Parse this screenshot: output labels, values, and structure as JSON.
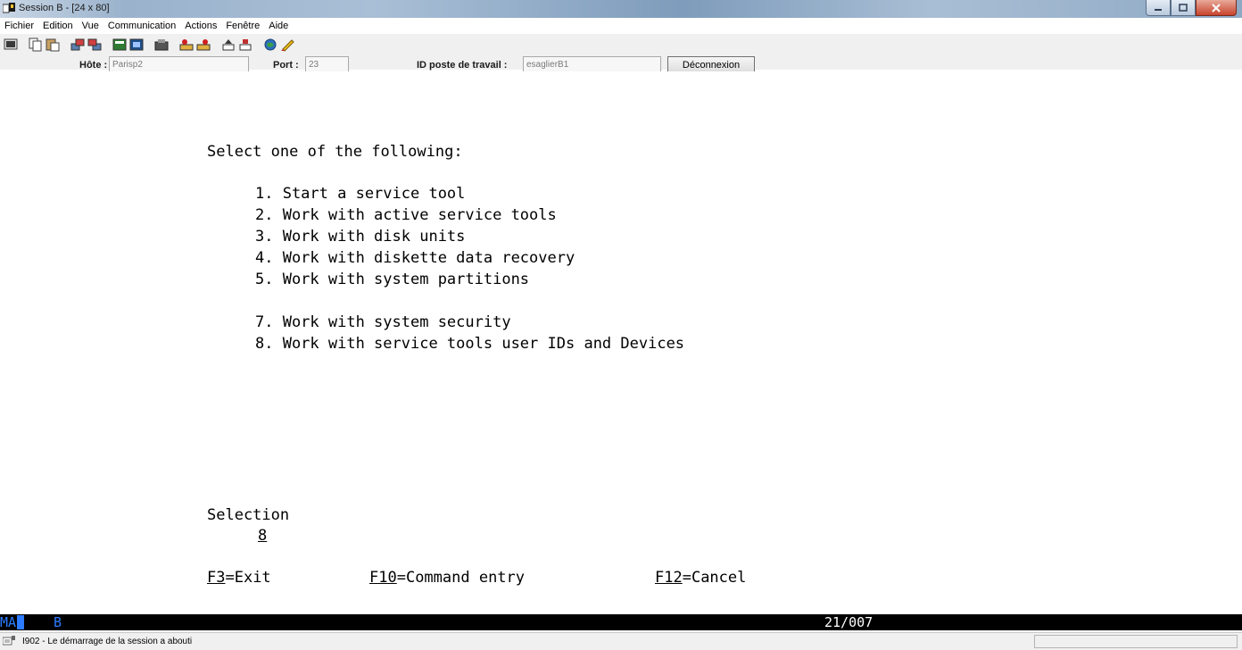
{
  "window": {
    "title": "Session B - [24 x 80]",
    "app_icon": "terminal-session-icon"
  },
  "menu": [
    "Fichier",
    "Edition",
    "Vue",
    "Communication",
    "Actions",
    "Fenêtre",
    "Aide"
  ],
  "toolbar": {
    "icons": [
      "print-screen-icon",
      "copy-icon",
      "paste-icon",
      "send-icon",
      "receive-icon",
      "display-icon",
      "keyboard-icon",
      "macro-icon",
      "record-macro-icon",
      "play-macro-icon",
      "start-icon",
      "stop-icon",
      "globe-icon",
      "help-icon"
    ]
  },
  "connection": {
    "host_label": "Hôte :",
    "host_value": "Parisp2",
    "port_label": "Port :",
    "port_value": "23",
    "workstation_label": "ID poste de travail :",
    "workstation_value": "esaglierB1",
    "disconnect_label": "Déconnexion"
  },
  "terminal": {
    "heading": "Select one of the following:",
    "options": [
      "1. Start a service tool",
      "2. Work with active service tools",
      "3. Work with disk units",
      "4. Work with diskette data recovery",
      "5. Work with system partitions",
      "7. Work with system security",
      "8. Work with service tools user IDs and Devices"
    ],
    "selection_label": "Selection",
    "selection_value": "8",
    "function_keys": [
      {
        "key": "F3",
        "text": "=Exit"
      },
      {
        "key": "F10",
        "text": "=Command entry"
      },
      {
        "key": "F12",
        "text": "=Cancel"
      }
    ]
  },
  "oia": {
    "mode": "MA",
    "session": "B",
    "cursor_position": "21/007",
    "colors": {
      "indicator": "#2d7cff",
      "background": "#000000"
    }
  },
  "status": {
    "message": "I902 - Le démarrage de la session a abouti"
  }
}
